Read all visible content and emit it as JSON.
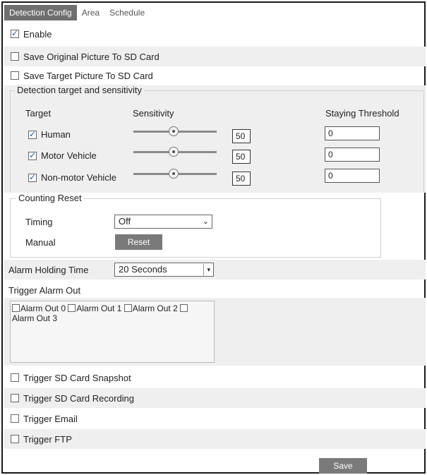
{
  "tabs": [
    {
      "label": "Detection Config",
      "active": true
    },
    {
      "label": "Area",
      "active": false
    },
    {
      "label": "Schedule",
      "active": false
    }
  ],
  "enable": {
    "label": "Enable",
    "checked": true
  },
  "save_original": {
    "label": "Save Original Picture To SD Card",
    "checked": false
  },
  "save_target": {
    "label": "Save Target Picture To SD Card",
    "checked": false
  },
  "detection": {
    "legend": "Detection target and sensitivity",
    "headers": {
      "target": "Target",
      "sensitivity": "Sensitivity",
      "staying": "Staying Threshold"
    },
    "rows": [
      {
        "label": "Human",
        "checked": true,
        "sensitivity": "50",
        "staying": "0"
      },
      {
        "label": "Motor Vehicle",
        "checked": true,
        "sensitivity": "50",
        "staying": "0"
      },
      {
        "label": "Non-motor Vehicle",
        "checked": true,
        "sensitivity": "50",
        "staying": "0"
      }
    ]
  },
  "counting_reset": {
    "legend": "Counting Reset",
    "timing_label": "Timing",
    "timing_value": "Off",
    "manual_label": "Manual",
    "reset_button": "Reset"
  },
  "alarm_holding": {
    "label": "Alarm Holding Time",
    "value": "20 Seconds"
  },
  "trigger_alarm_out": {
    "label": "Trigger Alarm Out",
    "options": [
      "Alarm Out 0",
      "Alarm Out 1",
      "Alarm Out 2",
      "Alarm Out 3"
    ]
  },
  "triggers": [
    {
      "label": "Trigger SD Card Snapshot",
      "checked": false
    },
    {
      "label": "Trigger SD Card Recording",
      "checked": false
    },
    {
      "label": "Trigger Email",
      "checked": false
    },
    {
      "label": "Trigger FTP",
      "checked": false
    }
  ],
  "save_button": "Save"
}
